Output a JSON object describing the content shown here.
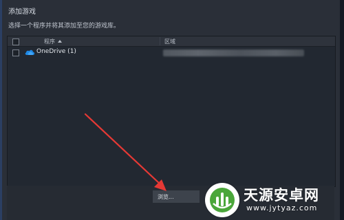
{
  "dialog": {
    "title": "添加游戏",
    "subtitle": "选择一个程序并将其添加至您的游戏库。"
  },
  "table": {
    "columns": {
      "program": "程序",
      "region": "区域"
    },
    "rows": [
      {
        "name": "OneDrive (1)",
        "icon": "onedrive-icon",
        "checked": false
      }
    ]
  },
  "footer": {
    "browse_label": "浏览..."
  },
  "annotation": {
    "arrow_color": "#e53935"
  },
  "watermark": {
    "title": "天源安卓网",
    "url": "www.jytyaz.com",
    "logo_color": "#4aa63a"
  },
  "colors": {
    "dialog_bg": "#2a2f38",
    "panel_bg": "#222831",
    "accent": "#2b3f63"
  }
}
